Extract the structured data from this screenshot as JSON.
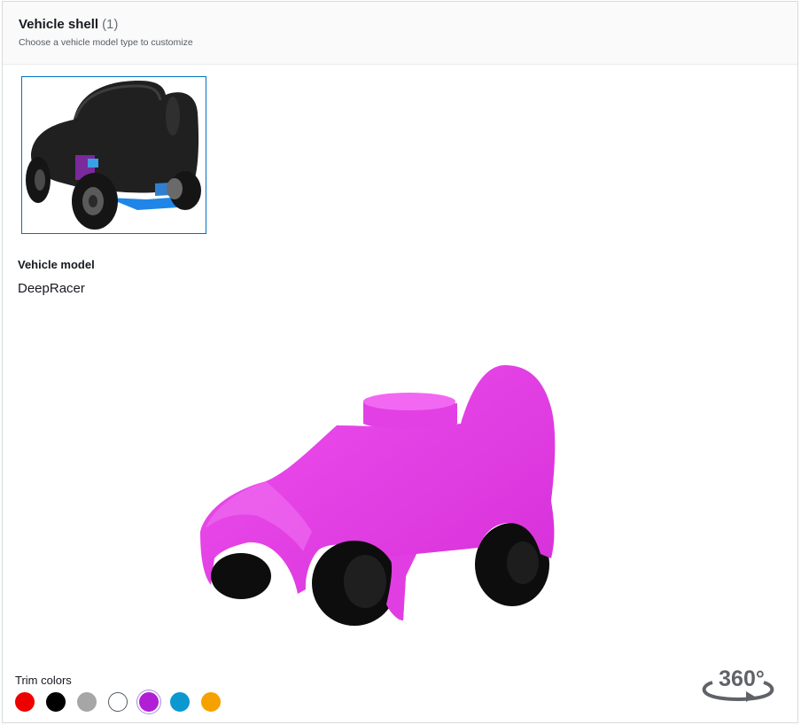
{
  "header": {
    "title": "Vehicle shell",
    "count": "(1)",
    "subtitle": "Choose a vehicle model type to customize"
  },
  "thumbnail": {
    "icon": "vehicle-shell-thumbnail",
    "selected": true,
    "selected_color": "#0073bb"
  },
  "model": {
    "label": "Vehicle model",
    "value": "DeepRacer"
  },
  "viewer": {
    "body_color": "#e43ee6",
    "tire_color": "#111111"
  },
  "trim": {
    "label": "Trim colors",
    "colors": [
      {
        "name": "red",
        "hex": "#ee0000"
      },
      {
        "name": "black",
        "hex": "#000000"
      },
      {
        "name": "gray",
        "hex": "#a6a6a6"
      },
      {
        "name": "white",
        "hex": "#ffffff"
      },
      {
        "name": "purple",
        "hex": "#b01ed6",
        "selected": true
      },
      {
        "name": "blue",
        "hex": "#0b98d0"
      },
      {
        "name": "orange",
        "hex": "#f5a100"
      }
    ]
  },
  "rotate": {
    "label": "360°",
    "icon": "rotate-360-icon"
  }
}
